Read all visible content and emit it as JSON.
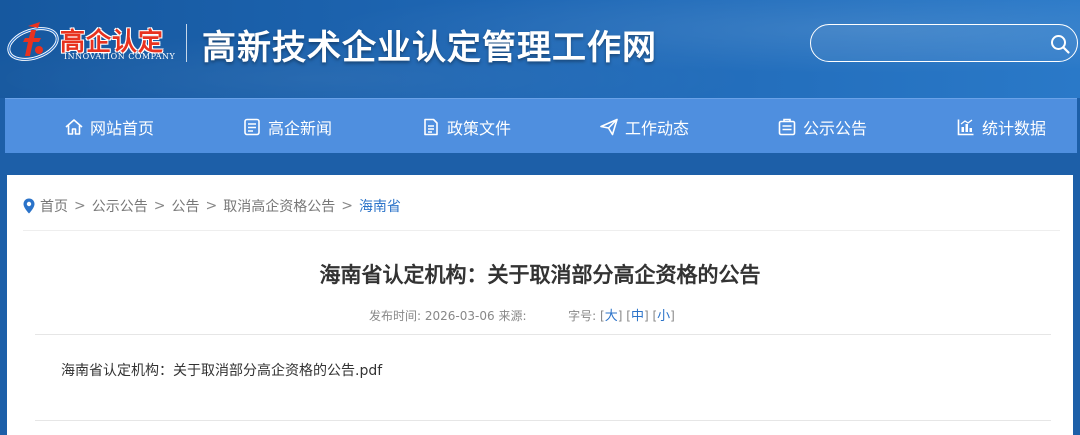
{
  "header": {
    "logo_cn": "高企认定",
    "logo_en": "INNOVATION COMPANY",
    "site_title": "高新技术企业认定管理工作网",
    "search": {
      "placeholder": "",
      "value": ""
    }
  },
  "nav": {
    "items": [
      {
        "label": "网站首页",
        "icon": "home-icon"
      },
      {
        "label": "高企新闻",
        "icon": "news-icon"
      },
      {
        "label": "政策文件",
        "icon": "document-icon"
      },
      {
        "label": "工作动态",
        "icon": "send-icon"
      },
      {
        "label": "公示公告",
        "icon": "clipboard-icon"
      },
      {
        "label": "统计数据",
        "icon": "chart-icon"
      }
    ]
  },
  "breadcrumb": {
    "items": [
      "首页",
      "公示公告",
      "公告",
      "取消高企资格公告"
    ],
    "current": "海南省",
    "separator": ">"
  },
  "article": {
    "title": "海南省认定机构：关于取消部分高企资格的公告",
    "publish_label": "发布时间:",
    "publish_date": "2026-03-06",
    "source_label": "来源:",
    "source": "",
    "font_size_label": "字号:",
    "font_sizes": [
      "大",
      "中",
      "小"
    ],
    "attachment": "海南省认定机构：关于取消部分高企资格的公告.pdf"
  },
  "colors": {
    "header_bg": "#1e66b3",
    "nav_bg": "#4f8fdf",
    "link": "#2b73c9",
    "logo_red": "#e8321f"
  }
}
